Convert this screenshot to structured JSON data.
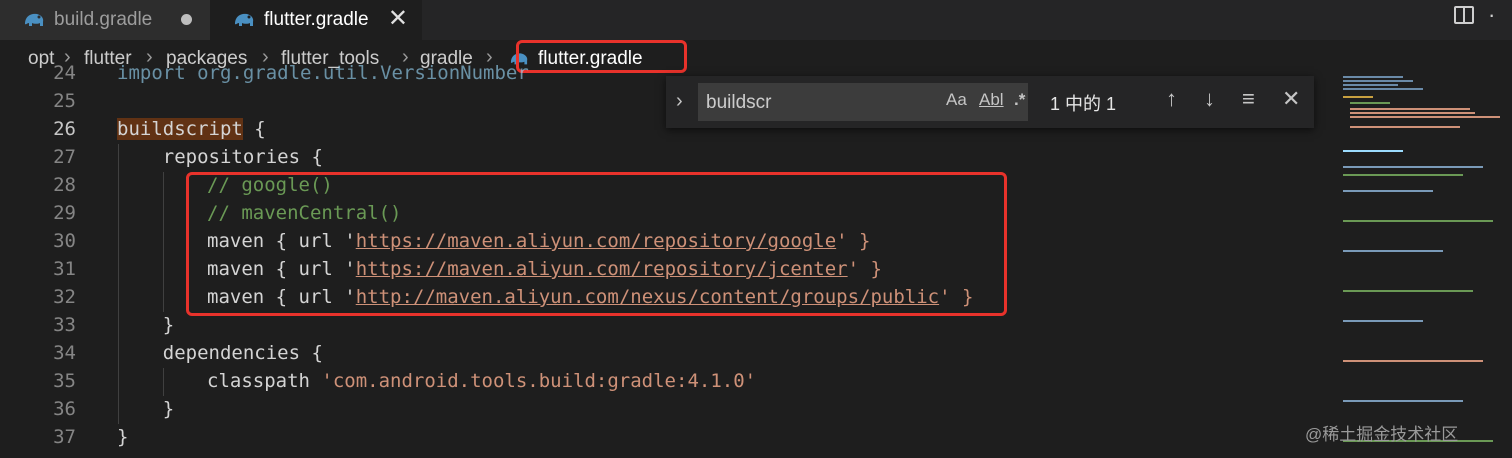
{
  "tabs": [
    {
      "label": "build.gradle",
      "icon": "gradle-elephant-icon",
      "modified": true
    },
    {
      "label": "flutter.gradle",
      "icon": "gradle-elephant-icon",
      "active": true
    }
  ],
  "breadcrumb": [
    "opt",
    "flutter",
    "packages",
    "flutter_tools",
    "gradle",
    "flutter.gradle"
  ],
  "find": {
    "query": "buildscr",
    "match_case_label": "Aa",
    "whole_word_label": "Abl",
    "regex_label": ".*",
    "result": "1 中的 1"
  },
  "editor": {
    "lines": [
      {
        "num": "24",
        "text": "import org.gradle.util.VersionNumber"
      },
      {
        "num": "25",
        "text": ""
      },
      {
        "num": "26",
        "keyword": "buildscript",
        "rest": " {"
      },
      {
        "num": "27",
        "text": "    repositories {"
      },
      {
        "num": "28",
        "comment": "// google()"
      },
      {
        "num": "29",
        "comment": "// mavenCentral()"
      },
      {
        "num": "30",
        "pre": "maven { url '",
        "url": "https://maven.aliyun.com/repository/google",
        "post": "' }"
      },
      {
        "num": "31",
        "pre": "maven { url '",
        "url": "https://maven.aliyun.com/repository/jcenter",
        "post": "' }"
      },
      {
        "num": "32",
        "pre": "maven { url '",
        "url": "http://maven.aliyun.com/nexus/content/groups/public",
        "post": "' }"
      },
      {
        "num": "33",
        "text": "    }"
      },
      {
        "num": "34",
        "text": "    dependencies {"
      },
      {
        "num": "35",
        "pre": "classpath ",
        "str": "'com.android.tools.build:gradle:4.1.0'"
      },
      {
        "num": "36",
        "text": "    }"
      },
      {
        "num": "37",
        "text": "}"
      }
    ]
  },
  "watermark": "@稀土掘金技术社区",
  "colors": {
    "highlight_box": "#e8322b",
    "comment": "#6a9955",
    "string": "#ce9178"
  }
}
